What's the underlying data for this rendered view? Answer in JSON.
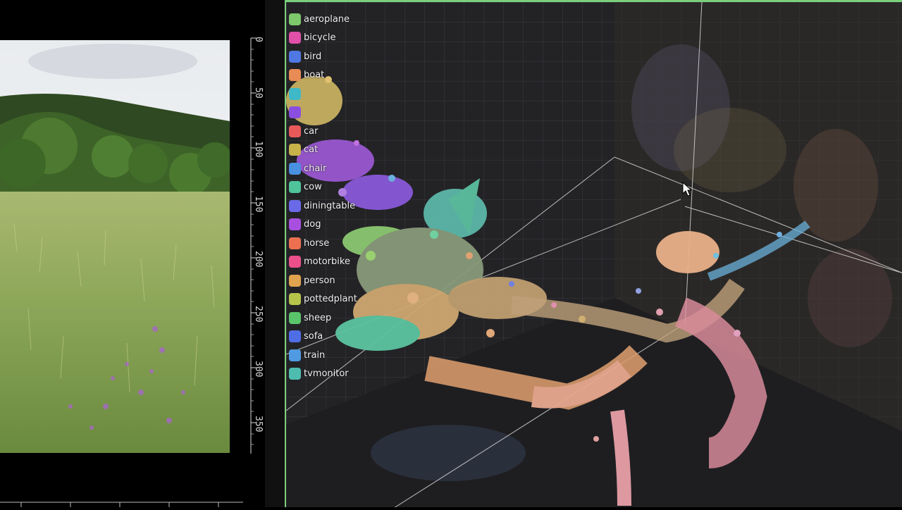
{
  "ruler": {
    "labels": [
      "0",
      "50",
      "100",
      "150",
      "200",
      "250",
      "300",
      "350"
    ]
  },
  "legend": {
    "items": [
      {
        "label": "aeroplane",
        "color": "#7cc86b"
      },
      {
        "label": "bicycle",
        "color": "#e04fa8"
      },
      {
        "label": "bird",
        "color": "#4f78e3"
      },
      {
        "label": "boat",
        "color": "#e98b55"
      },
      {
        "label": "",
        "color": "#3fb8c8"
      },
      {
        "label": "",
        "color": "#8a4fe0"
      },
      {
        "label": "car",
        "color": "#e85a5a"
      },
      {
        "label": "cat",
        "color": "#c8b24a"
      },
      {
        "label": "chair",
        "color": "#4a90e0"
      },
      {
        "label": "cow",
        "color": "#4fc49a"
      },
      {
        "label": "diningtable",
        "color": "#6a6ae8"
      },
      {
        "label": "dog",
        "color": "#a94fe0"
      },
      {
        "label": "horse",
        "color": "#ec7050"
      },
      {
        "label": "motorbike",
        "color": "#ec4f8a"
      },
      {
        "label": "person",
        "color": "#e0a44f"
      },
      {
        "label": "pottedplant",
        "color": "#b6c44a"
      },
      {
        "label": "sheep",
        "color": "#5ac46a"
      },
      {
        "label": "sofa",
        "color": "#4f6ee6"
      },
      {
        "label": "train",
        "color": "#4f9ae0"
      },
      {
        "label": "tvmonitor",
        "color": "#4fbcb0"
      }
    ]
  },
  "colors": {
    "viewer_border": "#7bd07b",
    "viewer_bg": "#1b1b1d"
  }
}
